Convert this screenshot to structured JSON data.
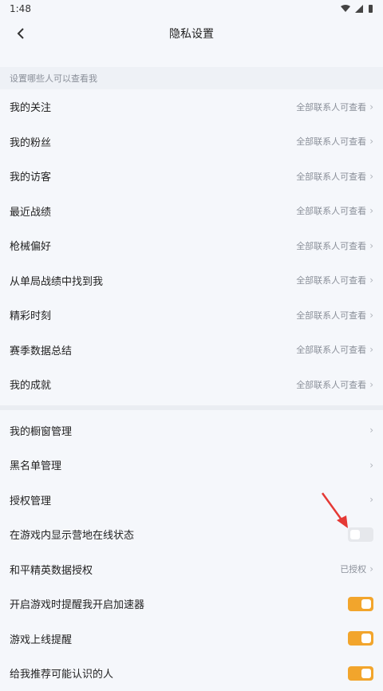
{
  "status": {
    "time": "1:48"
  },
  "header": {
    "title": "隐私设置"
  },
  "section": {
    "title": "设置哪些人可以查看我"
  },
  "visibility_items": [
    {
      "label": "我的关注",
      "value": "全部联系人可查看"
    },
    {
      "label": "我的粉丝",
      "value": "全部联系人可查看"
    },
    {
      "label": "我的访客",
      "value": "全部联系人可查看"
    },
    {
      "label": "最近战绩",
      "value": "全部联系人可查看"
    },
    {
      "label": "枪械偏好",
      "value": "全部联系人可查看"
    },
    {
      "label": "从单局战绩中找到我",
      "value": "全部联系人可查看"
    },
    {
      "label": "精彩时刻",
      "value": "全部联系人可查看"
    },
    {
      "label": "赛季数据总结",
      "value": "全部联系人可查看"
    },
    {
      "label": "我的成就",
      "value": "全部联系人可查看"
    }
  ],
  "other_items": [
    {
      "label": "我的橱窗管理"
    },
    {
      "label": "黑名单管理"
    },
    {
      "label": "授权管理"
    },
    {
      "label": "在游戏内显示营地在线状态",
      "toggle": false
    },
    {
      "label": "和平精英数据授权",
      "value": "已授权"
    },
    {
      "label": "开启游戏时提醒我开启加速器",
      "toggle": true
    },
    {
      "label": "游戏上线提醒",
      "toggle": true
    },
    {
      "label": "给我推荐可能认识的人",
      "toggle": true
    }
  ],
  "colors": {
    "accent": "#f2a52c",
    "arrow": "#e53935"
  }
}
